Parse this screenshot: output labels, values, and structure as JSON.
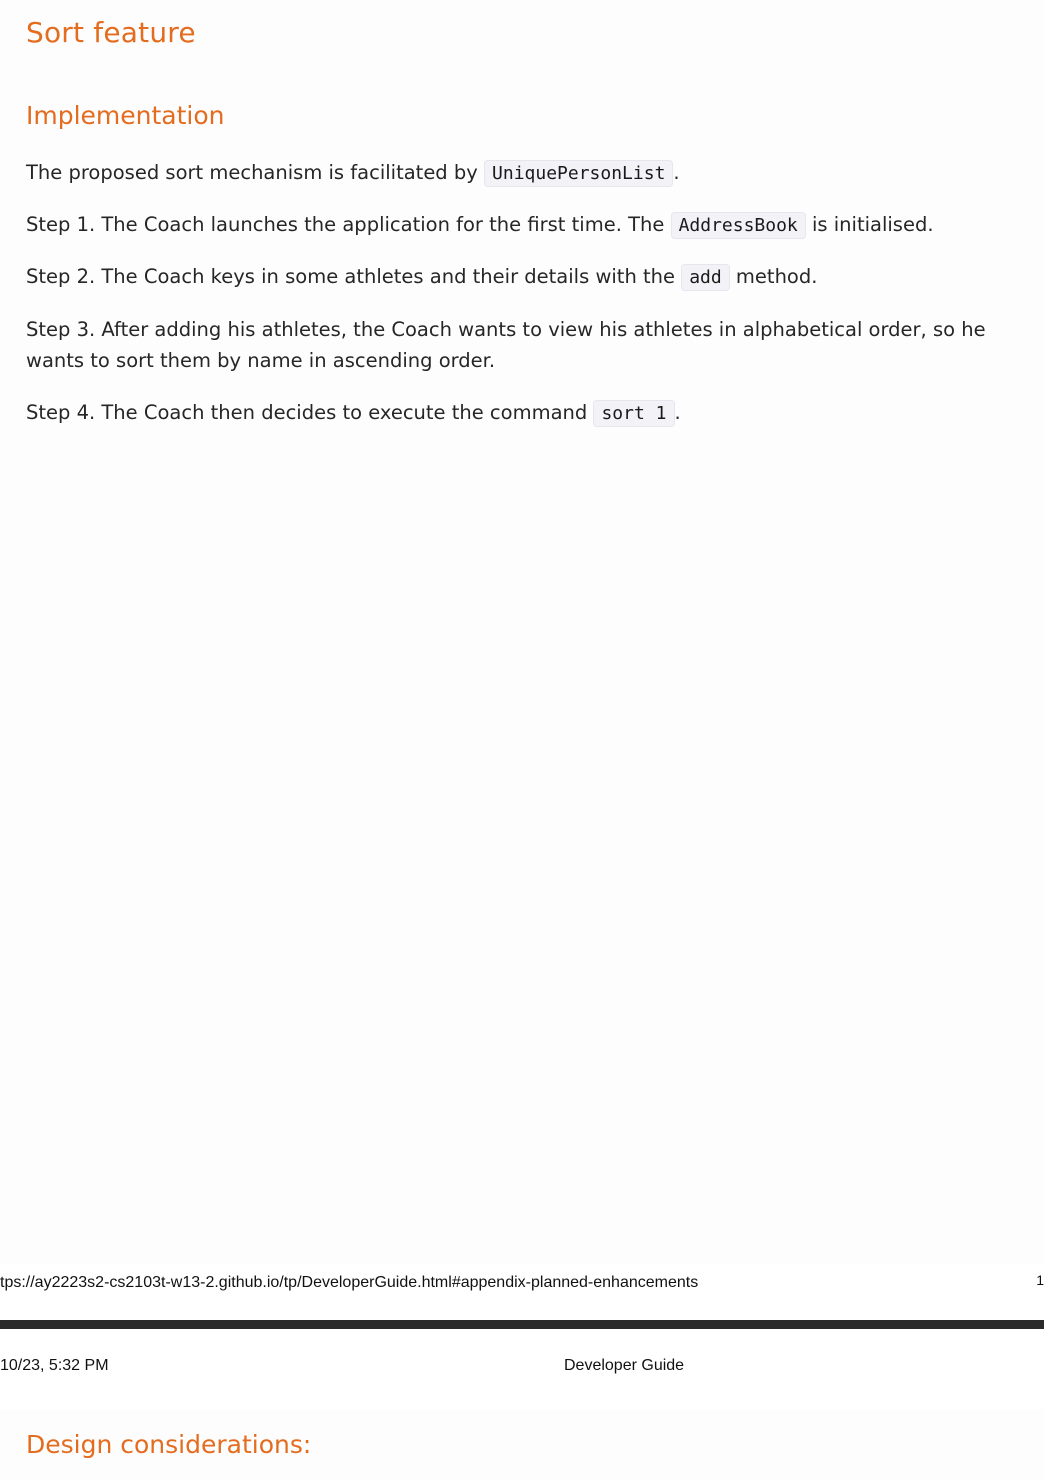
{
  "doc": {
    "section_title": "Sort feature",
    "subsection_title": "Implementation",
    "paragraphs": [
      {
        "before": "The proposed sort mechanism is facilitated by ",
        "code": "UniquePersonList",
        "after": "."
      },
      {
        "before": "Step 1. The Coach launches the application for the first time. The ",
        "code": "AddressBook",
        "after": " is initialised."
      },
      {
        "before": "Step 2. The Coach keys in some athletes and their details with the ",
        "code": "add",
        "after": " method."
      },
      {
        "text": "Step 3. After adding his athletes, the Coach wants to view his athletes in alphabetical order, so he wants to sort them by name in ascending order."
      },
      {
        "before": "Step 4. The Coach then decides to execute the command ",
        "code": "sort 1",
        "after": "."
      }
    ],
    "next_section_title": "Design considerations:"
  },
  "print": {
    "footer_url": "tps://ay2223s2-cs2103t-w13-2.github.io/tp/DeveloperGuide.html#appendix-planned-enhancements",
    "footer_page": "1",
    "header_date": "10/23, 5:32 PM",
    "header_title": "Developer Guide"
  }
}
